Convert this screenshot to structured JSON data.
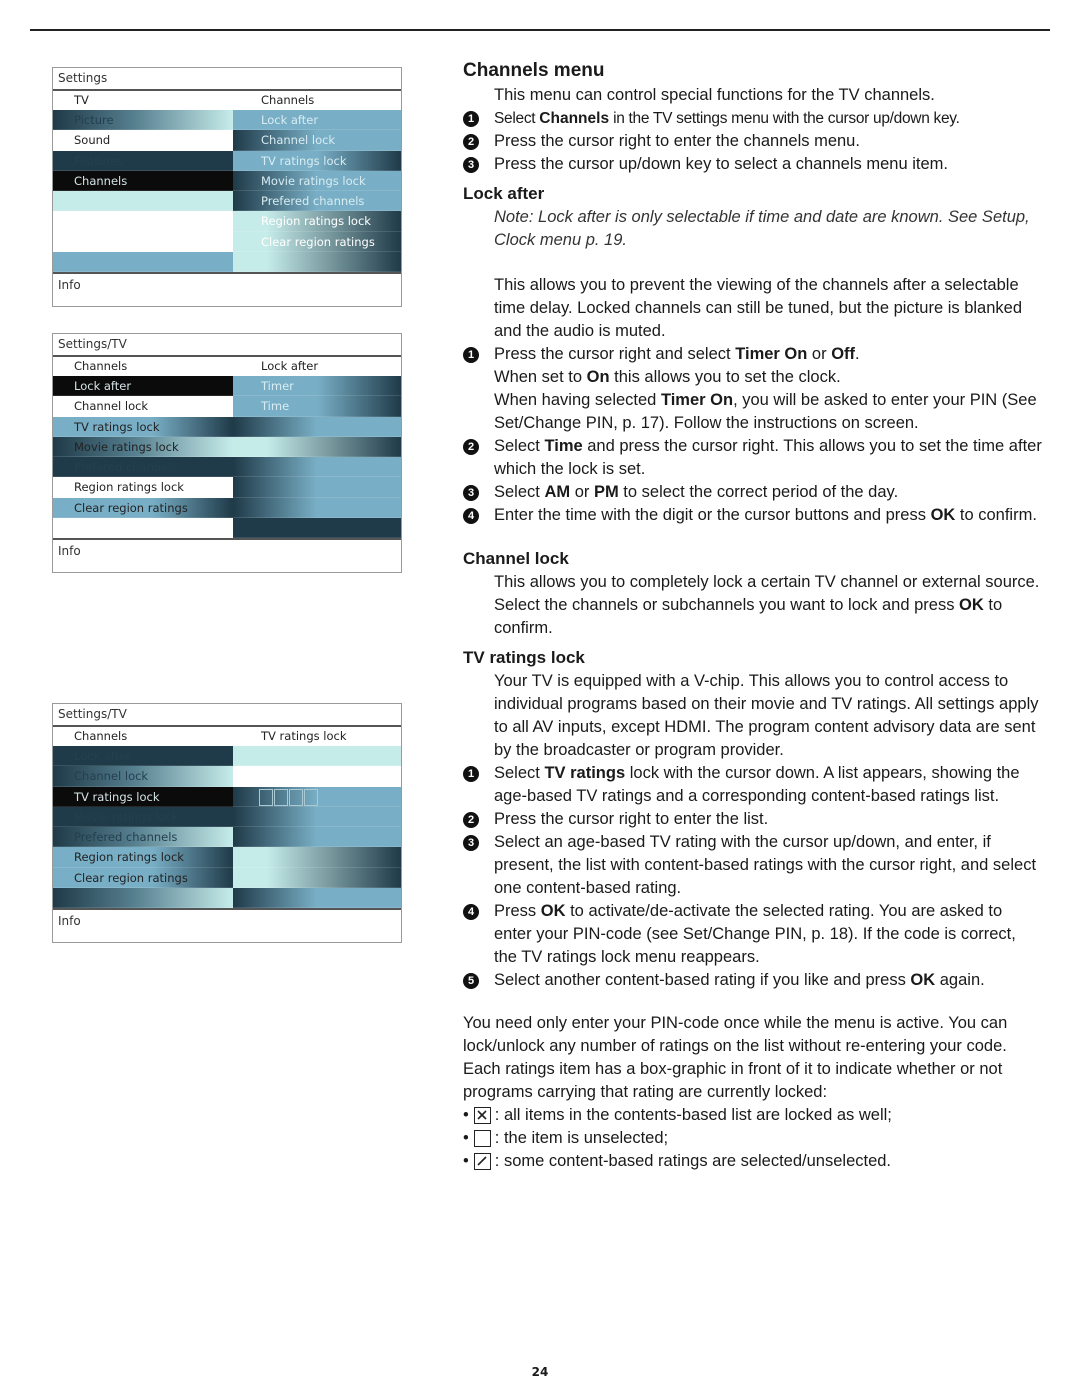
{
  "page_number": "24",
  "menus": [
    {
      "title": "Settings",
      "left_header": "TV",
      "right_header": "Channels",
      "left_items": [
        "Picture",
        "Sound",
        "Features",
        "Channels",
        "",
        "",
        "",
        ""
      ],
      "right_items": [
        "Lock after",
        "Channel lock",
        "TV ratings lock",
        "Movie ratings lock",
        "Prefered channels",
        "Region ratings lock",
        "Clear region ratings",
        ""
      ],
      "selected": "Channels",
      "info": "Info"
    },
    {
      "title": "Settings/TV",
      "left_header": "Channels",
      "right_header": "Lock after",
      "left_items": [
        "Lock after",
        "Channel lock",
        "TV ratings lock",
        "Movie ratings lock",
        "Prefered channels",
        "Region ratings lock",
        "Clear region ratings",
        ""
      ],
      "right_items": [
        "Timer",
        "Time",
        "",
        "",
        "",
        "",
        "",
        ""
      ],
      "selected": "Lock after",
      "info": "Info"
    },
    {
      "title": "Settings/TV",
      "left_header": "Channels",
      "right_header": "TV ratings lock",
      "left_items": [
        "Lock after",
        "Channel lock",
        "TV ratings lock",
        "Movie ratings lock",
        "Prefered channels",
        "Region ratings lock",
        "Clear region ratings",
        ""
      ],
      "right_items": [
        "",
        "",
        "",
        "",
        "",
        "",
        "",
        ""
      ],
      "selected": "TV ratings lock",
      "rating_boxes": 4,
      "info": "Info"
    }
  ],
  "content": {
    "title": "Channels menu",
    "intro": "This menu can control special functions for the TV channels.",
    "intro_steps": [
      {
        "n": "1",
        "pre": "Select ",
        "bold": "Channels",
        "post": " in the TV settings menu with the cursor up/down key."
      },
      {
        "n": "2",
        "text": "Press the cursor right to enter the channels menu."
      },
      {
        "n": "3",
        "text": "Press the cursor up/down key to select a channels menu item."
      }
    ],
    "lock_after": {
      "heading": "Lock after",
      "note": "Note: Lock after is only selectable if time and date are known. See Setup, Clock menu p. 19.",
      "desc": "This allows you to prevent the viewing of the channels after a selectable time delay. Locked channels can still be tuned, but the picture is blanked and the audio is muted.",
      "step1_a": "Press the cursor right and select ",
      "step1_b": "Timer On",
      "step1_c": " or ",
      "step1_d": "Off",
      "step1_e": ".",
      "step1_l2a": "When set to ",
      "step1_l2b": "On",
      "step1_l2c": " this allows you to set the clock.",
      "step1_l3a": "When having selected ",
      "step1_l3b": "Timer On",
      "step1_l3c": ", you will be asked to enter your PIN (See Set/Change PIN, p. 17). Follow the instructions on screen.",
      "step2_a": "Select ",
      "step2_b": "Time",
      "step2_c": " and press the cursor right. This allows you to set the time after which the lock is set.",
      "step3_a": "Select ",
      "step3_b": "AM",
      "step3_c": " or ",
      "step3_d": "PM",
      "step3_e": " to select the correct period of the day.",
      "step4_a": "Enter the time with the digit or the cursor buttons and press ",
      "step4_b": "OK",
      "step4_c": " to confirm."
    },
    "channel_lock": {
      "heading": "Channel lock",
      "desc_a": "This allows you to completely lock a certain TV channel or external source. Select the channels or subchannels you want to lock and press ",
      "desc_b": "OK",
      "desc_c": " to confirm."
    },
    "tv_ratings_lock": {
      "heading": "TV ratings lock",
      "desc": "Your TV is equipped with a V-chip. This allows you to control access to individual programs based on their movie and TV ratings. All settings apply to all AV inputs, except HDMI. The program content advisory data are sent by the broadcaster or program provider.",
      "step1_a": "Select ",
      "step1_b": "TV ratings",
      "step1_c": " lock with the cursor down. A list appears, showing the age-based TV ratings and a corresponding content-based ratings list.",
      "step2": "Press the cursor right to enter the list.",
      "step3": "Select an age-based TV rating with the cursor up/down, and enter, if present, the list with content-based ratings with the cursor right, and select one content-based rating.",
      "step4_a": "Press ",
      "step4_b": "OK",
      "step4_c": " to activate/de-activate the selected rating. You are asked to enter your PIN-code (see Set/Change PIN, p. 18). If the code is correct, the TV ratings lock menu reappears.",
      "step5_a": "Select another content-based rating if you like and press ",
      "step5_b": "OK",
      "step5_c": " again.",
      "pin_note": "You need only enter your PIN-code once while the menu is active. You can lock/unlock any number of ratings on the list without re-entering your code.",
      "box_intro": "Each ratings item has a box-graphic in front of it to indicate whether or not programs carrying that rating are currently locked:",
      "legend": [
        {
          "icon": "box-x-icon",
          "text": ": all items in the contents-based list are locked as well;"
        },
        {
          "icon": "box-empty-icon",
          "text": ": the item is unselected;"
        },
        {
          "icon": "box-slash-icon",
          "text": ": some content-based ratings are selected/unselected."
        }
      ]
    }
  }
}
